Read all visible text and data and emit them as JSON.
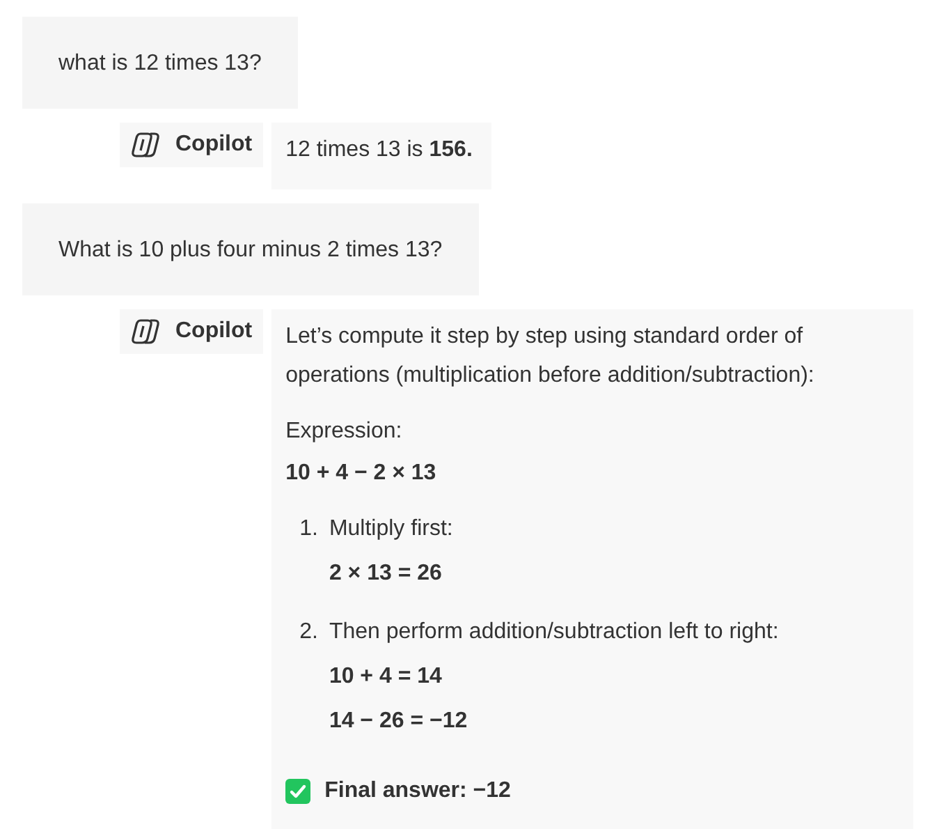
{
  "messages": [
    {
      "kind": "user",
      "text": "what is 12 times 13?"
    },
    {
      "kind": "assistant",
      "sender": "Copilot",
      "blocks": [
        {
          "kind": "paragraph",
          "text": "12 times 13 is **156.**"
        }
      ]
    },
    {
      "kind": "user",
      "text": "What is 10 plus four minus 2 times 13?"
    },
    {
      "kind": "assistant",
      "sender": "Copilot",
      "blocks": [
        {
          "kind": "paragraph",
          "text": "Let’s compute it step by step using standard order of operations (multiplication before addition/subtraction):"
        },
        {
          "kind": "label",
          "text": "Expression:"
        },
        {
          "kind": "math",
          "text": "10 + 4 − 2 × 13"
        },
        {
          "kind": "list",
          "items": [
            {
              "marker": "1.",
              "title": "Multiply first:",
              "lines": [
                "2 × 13 = 26"
              ]
            },
            {
              "marker": "2.",
              "title": "Then perform addition/subtraction left to right:",
              "lines": [
                "10 + 4 = 14",
                "14 − 26 = −12"
              ]
            }
          ]
        },
        {
          "kind": "check",
          "text": "Final answer: −12"
        }
      ]
    }
  ]
}
